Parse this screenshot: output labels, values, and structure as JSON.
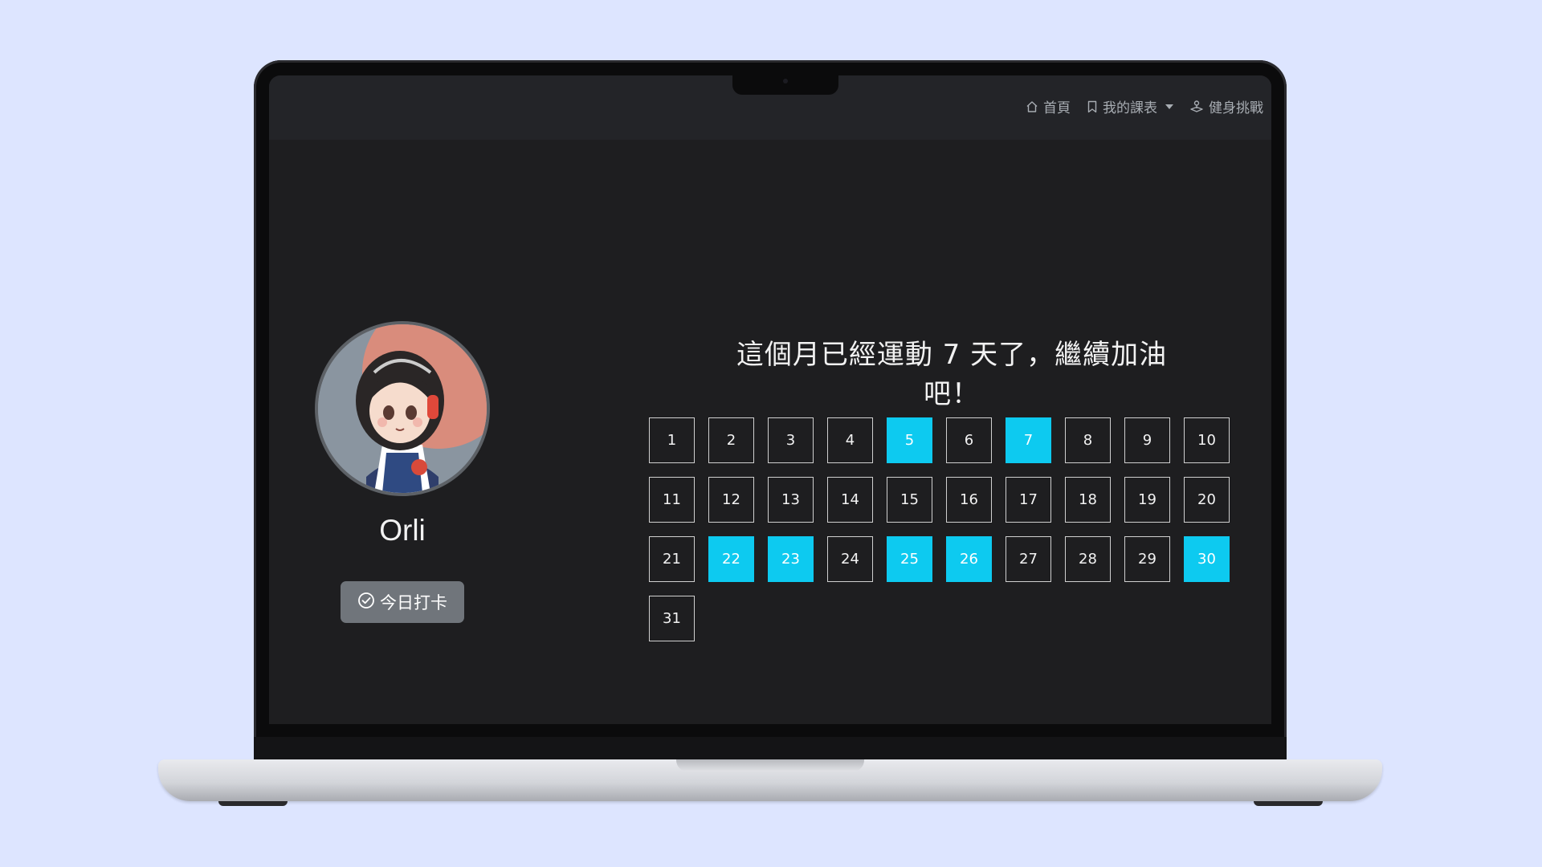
{
  "nav": {
    "home": "首頁",
    "my_courses": "我的課表",
    "challenge": "健身挑戰"
  },
  "profile": {
    "username": "Orli",
    "checkin_label": "今日打卡"
  },
  "headline": "這個月已經運動 7 天了，繼續加油吧！",
  "calendar": {
    "days": [
      "1",
      "2",
      "3",
      "4",
      "5",
      "6",
      "7",
      "8",
      "9",
      "10",
      "11",
      "12",
      "13",
      "14",
      "15",
      "16",
      "17",
      "18",
      "19",
      "20",
      "21",
      "22",
      "23",
      "24",
      "25",
      "26",
      "27",
      "28",
      "29",
      "30",
      "31"
    ],
    "active_days": [
      "5",
      "7",
      "22",
      "23",
      "25",
      "26",
      "30"
    ]
  },
  "colors": {
    "page_background": "#dde5ff",
    "screen_background": "#1e1e20",
    "navbar_background": "#232428",
    "active_day": "#0dcaf0",
    "button_gray": "#70757b"
  },
  "icons": {
    "home": "home-icon",
    "bookmark": "bookmark-icon",
    "challenge": "joystick-icon",
    "checkin": "check-circle-icon"
  }
}
